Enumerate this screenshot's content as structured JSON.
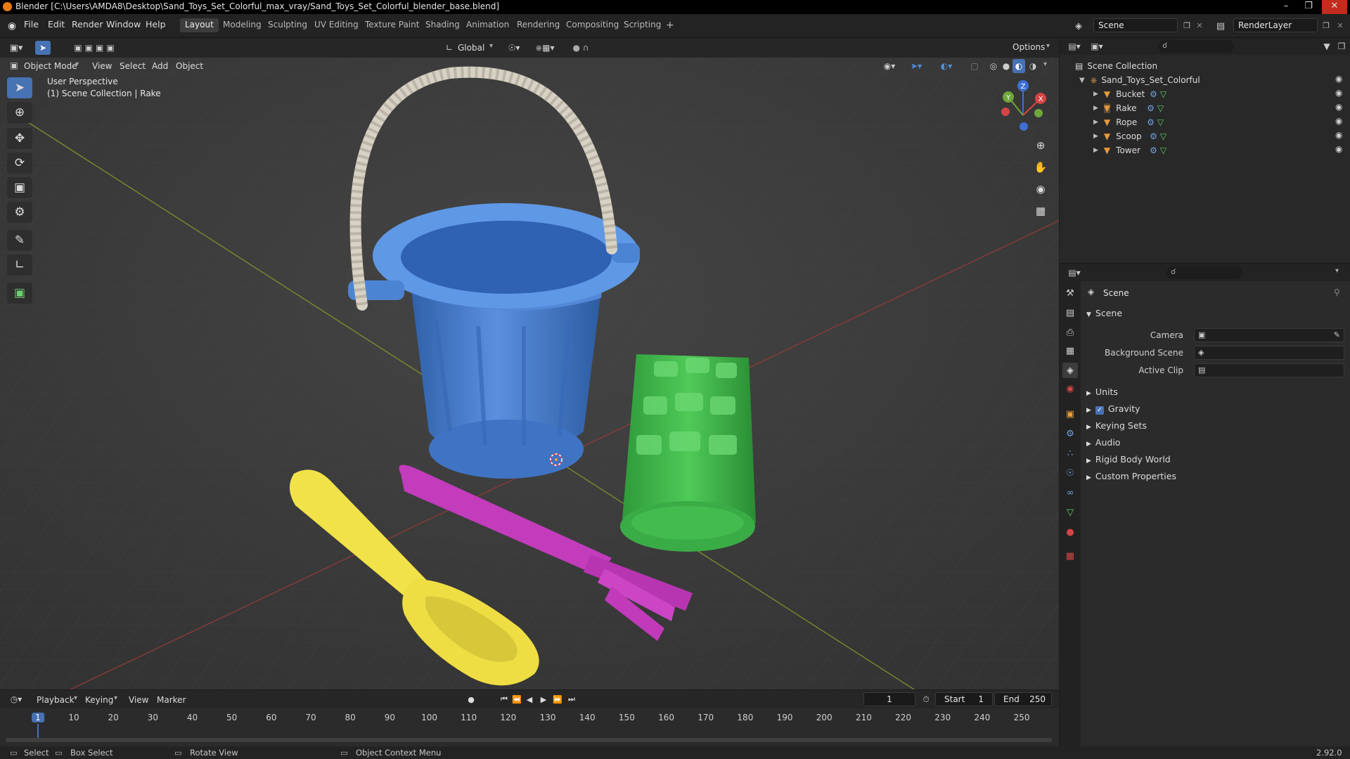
{
  "window": {
    "title": "Blender [C:\\Users\\AMDA8\\Desktop\\Sand_Toys_Set_Colorful_max_vray/Sand_Toys_Set_Colorful_blender_base.blend]"
  },
  "menu": [
    "File",
    "Edit",
    "Render",
    "Window",
    "Help"
  ],
  "workspaces": [
    "Layout",
    "Modeling",
    "Sculpting",
    "UV Editing",
    "Texture Paint",
    "Shading",
    "Animation",
    "Rendering",
    "Compositing",
    "Scripting"
  ],
  "active_workspace": "Layout",
  "topbar": {
    "scene": "Scene",
    "view_layer": "RenderLayer"
  },
  "viewport": {
    "mode": "Object Mode",
    "menus": [
      "View",
      "Select",
      "Add",
      "Object"
    ],
    "transform_orientation": "Global",
    "options_label": "Options",
    "overlay_line1": "User Perspective",
    "overlay_line2": "(1) Scene Collection | Rake",
    "gizmo": {
      "x": "X",
      "y": "Y",
      "z": "Z"
    }
  },
  "outliner": {
    "root": "Scene Collection",
    "collection": "Sand_Toys_Set_Colorful",
    "objects": [
      "Bucket",
      "Rake",
      "Rope",
      "Scoop",
      "Tower"
    ]
  },
  "properties": {
    "context": "Scene",
    "panel": "Scene",
    "fields": [
      {
        "label": "Camera"
      },
      {
        "label": "Background Scene"
      },
      {
        "label": "Active Clip"
      }
    ],
    "sections": [
      "Units",
      "Gravity",
      "Keying Sets",
      "Audio",
      "Rigid Body World",
      "Custom Properties"
    ],
    "gravity_checked": true
  },
  "timeline": {
    "menus": [
      "Playback",
      "Keying",
      "View",
      "Marker"
    ],
    "current_frame": "1",
    "start_label": "Start",
    "start": "1",
    "end_label": "End",
    "end": "250",
    "ticks": [
      "1",
      "10",
      "20",
      "30",
      "40",
      "50",
      "60",
      "70",
      "80",
      "90",
      "100",
      "110",
      "120",
      "130",
      "140",
      "150",
      "160",
      "170",
      "180",
      "190",
      "200",
      "210",
      "220",
      "230",
      "240",
      "250"
    ],
    "cursor_frame": "1"
  },
  "status": {
    "select": "Select",
    "box_select": "Box Select",
    "rotate": "Rotate View",
    "context_menu": "Object Context Menu",
    "version": "2.92.0"
  },
  "colors": {
    "accent": "#4772b3",
    "bucket": "#4a7fd0",
    "scoop": "#f2e24a",
    "rake": "#c23cbc",
    "tower": "#3fb64a",
    "rope": "#d8d2c4"
  }
}
